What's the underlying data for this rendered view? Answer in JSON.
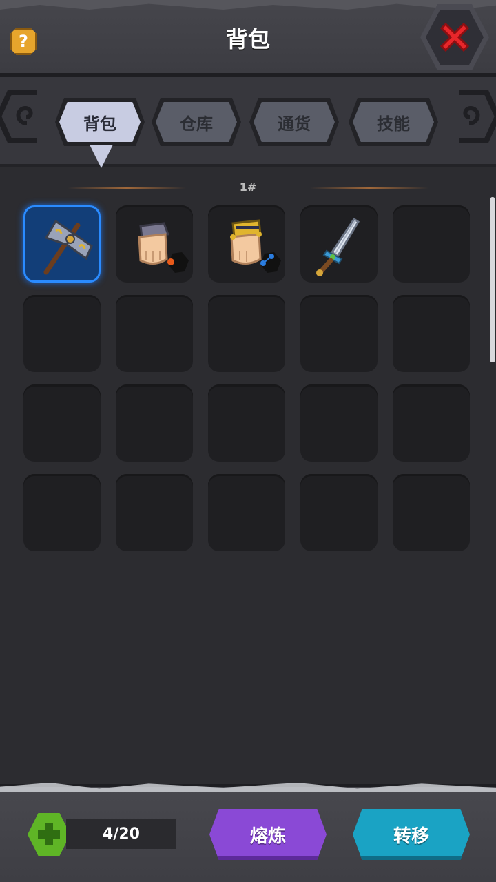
{
  "header": {
    "title": "背包",
    "help_symbol": "?"
  },
  "tabs": [
    {
      "label": "背包",
      "active": true
    },
    {
      "label": "仓库",
      "active": false
    },
    {
      "label": "通货",
      "active": false
    },
    {
      "label": "技能",
      "active": false
    }
  ],
  "page": {
    "number": "1#"
  },
  "inventory": {
    "slots": [
      {
        "item": "battle-axe",
        "selected": true
      },
      {
        "item": "glove-leather"
      },
      {
        "item": "glove-gold"
      },
      {
        "item": "sword"
      },
      {
        "item": null
      },
      {
        "item": null
      },
      {
        "item": null
      },
      {
        "item": null
      },
      {
        "item": null
      },
      {
        "item": null
      },
      {
        "item": null
      },
      {
        "item": null
      },
      {
        "item": null
      },
      {
        "item": null
      },
      {
        "item": null
      },
      {
        "item": null
      },
      {
        "item": null
      },
      {
        "item": null
      },
      {
        "item": null
      },
      {
        "item": null
      }
    ]
  },
  "bottom": {
    "capacity": "4/20",
    "smelt_label": "熔炼",
    "transfer_label": "转移"
  },
  "colors": {
    "accent_selected": "#2a8bff",
    "smelt": "#8a49d6",
    "transfer": "#1aa3c4",
    "capacity": "#5fb526",
    "close": "#e8262a"
  }
}
